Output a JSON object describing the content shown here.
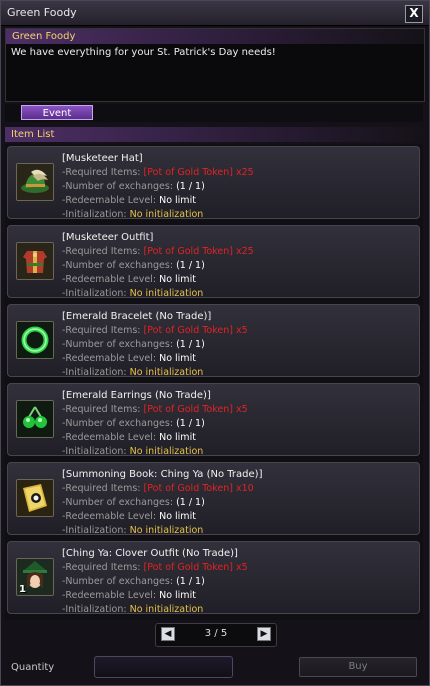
{
  "window": {
    "title": "Green Foody",
    "close_symbol": "X"
  },
  "npc": {
    "name": "Green Foody",
    "message": "We have everything for your St. Patrick's Day needs!"
  },
  "tabs": [
    {
      "label": "Event"
    }
  ],
  "item_list": {
    "header": "Item List",
    "labels": {
      "required_items": "-Required Items:",
      "number_of_exchanges": "-Number of exchanges:",
      "redeemable_level": "-Redeemable Level:",
      "initialization": "-Initialization:"
    },
    "items": [
      {
        "name": "[Musketeer Hat]",
        "required_items": "[Pot of Gold Token] x25",
        "exchanges": "(1 / 1)",
        "level": "No limit",
        "initialization": "No initialization",
        "icon": "musketeer-hat-icon",
        "quantity": ""
      },
      {
        "name": "[Musketeer Outfit]",
        "required_items": "[Pot of Gold Token] x25",
        "exchanges": "(1 / 1)",
        "level": "No limit",
        "initialization": "No initialization",
        "icon": "musketeer-outfit-icon",
        "quantity": ""
      },
      {
        "name": "[Emerald Bracelet (No Trade)]",
        "required_items": "[Pot of Gold Token] x5",
        "exchanges": "(1 / 1)",
        "level": "No limit",
        "initialization": "No initialization",
        "icon": "emerald-bracelet-icon",
        "quantity": ""
      },
      {
        "name": "[Emerald Earrings (No Trade)]",
        "required_items": "[Pot of Gold Token] x5",
        "exchanges": "(1 / 1)",
        "level": "No limit",
        "initialization": "No initialization",
        "icon": "emerald-earrings-icon",
        "quantity": ""
      },
      {
        "name": "[Summoning Book: Ching Ya (No Trade)]",
        "required_items": "[Pot of Gold Token] x10",
        "exchanges": "(1 / 1)",
        "level": "No limit",
        "initialization": "No initialization",
        "icon": "summoning-book-icon",
        "quantity": ""
      },
      {
        "name": "[Ching Ya: Clover Outfit (No Trade)]",
        "required_items": "[Pot of Gold Token] x5",
        "exchanges": "(1 / 1)",
        "level": "No limit",
        "initialization": "No initialization",
        "icon": "clover-outfit-icon",
        "quantity": "1"
      }
    ]
  },
  "pagination": {
    "text": "3 / 5",
    "prev_symbol": "◀",
    "next_symbol": "▶"
  },
  "footer": {
    "quantity_label": "Quantity",
    "quantity_value": "",
    "buy_label": "Buy"
  },
  "colors": {
    "required_items": "#e02424",
    "initialization": "#e6c24a",
    "header_text": "#f5d36a",
    "tab_active": "#8a53c5"
  }
}
